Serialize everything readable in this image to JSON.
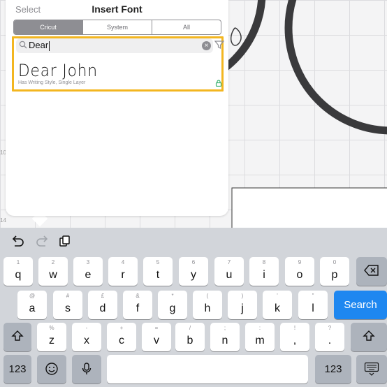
{
  "popover": {
    "select_label": "Select",
    "title": "Insert Font",
    "tabs": [
      {
        "label": "Cricut",
        "active": true
      },
      {
        "label": "System",
        "active": false
      },
      {
        "label": "All",
        "active": false
      }
    ],
    "search": {
      "value": "Dear"
    },
    "result": {
      "font_name": "Dear John",
      "description": "Has Writing Style, Single Layer"
    },
    "highlight_color": "#f3b620"
  },
  "canvas": {
    "ruler_marks": [
      "10",
      "14"
    ]
  },
  "keyboard": {
    "row1": [
      {
        "sec": "1",
        "pri": "q"
      },
      {
        "sec": "2",
        "pri": "w"
      },
      {
        "sec": "3",
        "pri": "e"
      },
      {
        "sec": "4",
        "pri": "r"
      },
      {
        "sec": "5",
        "pri": "t"
      },
      {
        "sec": "6",
        "pri": "y"
      },
      {
        "sec": "7",
        "pri": "u"
      },
      {
        "sec": "8",
        "pri": "i"
      },
      {
        "sec": "9",
        "pri": "o"
      },
      {
        "sec": "0",
        "pri": "p"
      }
    ],
    "row2": [
      {
        "sec": "@",
        "pri": "a"
      },
      {
        "sec": "#",
        "pri": "s"
      },
      {
        "sec": "£",
        "pri": "d"
      },
      {
        "sec": "&",
        "pri": "f"
      },
      {
        "sec": "*",
        "pri": "g"
      },
      {
        "sec": "(",
        "pri": "h"
      },
      {
        "sec": ")",
        "pri": "j"
      },
      {
        "sec": "'",
        "pri": "k"
      },
      {
        "sec": "\"",
        "pri": "l"
      }
    ],
    "row3": [
      {
        "sec": "%",
        "pri": "z"
      },
      {
        "sec": "-",
        "pri": "x"
      },
      {
        "sec": "+",
        "pri": "c"
      },
      {
        "sec": "=",
        "pri": "v"
      },
      {
        "sec": "/",
        "pri": "b"
      },
      {
        "sec": ";",
        "pri": "n"
      },
      {
        "sec": ":",
        "pri": "m"
      },
      {
        "sec": "!",
        "pri": ","
      },
      {
        "sec": "?",
        "pri": "."
      }
    ],
    "search_label": "Search",
    "numbers_label": "123",
    "accent_color": "#1e87f0"
  }
}
